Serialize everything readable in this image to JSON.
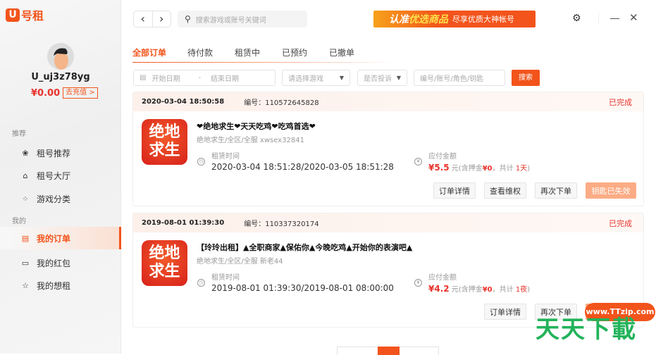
{
  "app": {
    "logo_text": "U号租"
  },
  "user": {
    "name": "U_uj3z78yg",
    "balance": "¥0.00",
    "recharge": "去充值 >"
  },
  "sidebar": {
    "section_recommend": "推荐",
    "section_mine": "我的",
    "items": [
      {
        "label": "租号推荐",
        "icon": "flower-icon"
      },
      {
        "label": "租号大厅",
        "icon": "home-icon"
      },
      {
        "label": "游戏分类",
        "icon": "grid-icon"
      },
      {
        "label": "我的订单",
        "icon": "order-icon",
        "active": true
      },
      {
        "label": "我的红包",
        "icon": "wallet-icon"
      },
      {
        "label": "我的想租",
        "icon": "star-icon"
      }
    ]
  },
  "topbar": {
    "back": "‹",
    "forward": "›",
    "search_placeholder": "搜索游戏或账号关键词",
    "banner_main": "认准",
    "banner_highlight": "优选商品",
    "banner_sub": "尽享优质大神帐号"
  },
  "tabs": [
    "全部订单",
    "待付款",
    "租赁中",
    "已预约",
    "已撤单"
  ],
  "filters": {
    "start_date": "开始日期",
    "dash": "-",
    "end_date": "结束日期",
    "game": "请选择游戏",
    "complaint": "是否投诉",
    "keyword": "编号/账号/角色/钥匙",
    "search": "搜索"
  },
  "orders": [
    {
      "time": "2020-03-04 18:50:58",
      "number": "编号：110572645828",
      "status": "已完成",
      "game_icon": "绝地求生",
      "title": "❤绝地求生❤天天吃鸡❤吃鸡首选❤",
      "sub": "绝地求生/全区/全服    xwsex32841",
      "rent_label": "租赁时间",
      "rent_time": "2020-03-04 18:51:28/2020-03-05 18:51:28",
      "pay_label": "应付金额",
      "price": "¥5.5",
      "price_text1": " 元(含押金",
      "deposit": "¥0",
      "price_text2": "，共计 ",
      "duration": "1天",
      "price_text3": ")",
      "buttons": [
        "订单详情",
        "查看维权",
        "再次下单",
        "钥匙已失效"
      ]
    },
    {
      "time": "2019-08-01 01:39:30",
      "number": "编号：110337320174",
      "status": "已完成",
      "game_icon": "绝地求生",
      "title": "【玲玲出租】▲全职商家▲保佑你▲今晚吃鸡▲开始你的表演吧▲",
      "sub": "绝地求生/全区/全服    新老44",
      "rent_label": "租赁时间",
      "rent_time": "2019-08-01 01:39:30/2019-08-01 08:00:00",
      "pay_label": "应付金额",
      "price": "¥4.2",
      "price_text1": " 元(含押金",
      "deposit": "¥0",
      "price_text2": "，共计 ",
      "duration": "1夜",
      "price_text3": ")",
      "buttons": [
        "订单详情",
        "再次下单"
      ]
    }
  ],
  "watermark": {
    "url": "www.TTzip.com",
    "brand": "天天下載"
  }
}
